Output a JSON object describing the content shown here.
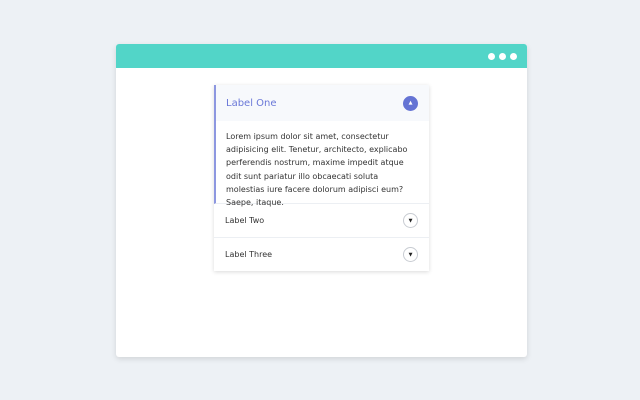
{
  "window": {
    "menu_icon": "more-horizontal-icon",
    "header_color": "#52d5c8"
  },
  "accordion": {
    "accent": "#6574d4",
    "items": [
      {
        "label": "Label One",
        "expanded": true,
        "icon": "chevron-up-icon",
        "content": "Lorem ipsum dolor sit amet, consectetur adipisicing elit. Tenetur, architecto, explicabo perferendis nostrum, maxime impedit atque odit sunt pariatur illo obcaecati soluta molestias iure facere dolorum adipisci eum? Saepe, itaque."
      },
      {
        "label": "Label Two",
        "expanded": false,
        "icon": "chevron-down-icon"
      },
      {
        "label": "Label Three",
        "expanded": false,
        "icon": "chevron-down-icon"
      }
    ]
  }
}
